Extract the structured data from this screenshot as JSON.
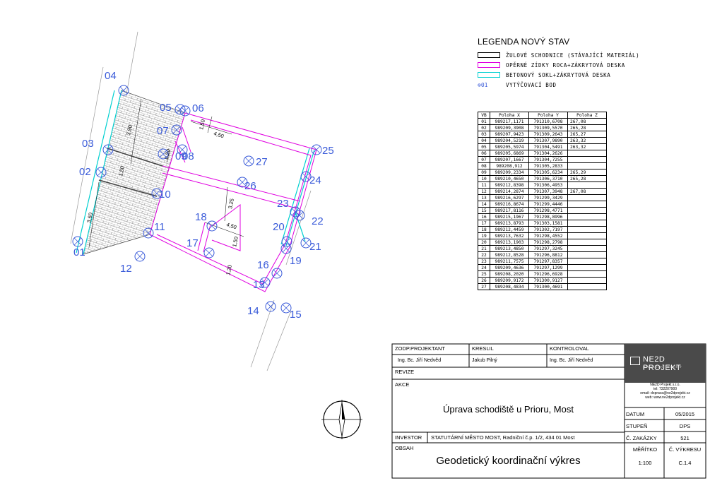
{
  "legend": {
    "title": "LEGENDA NOVÝ STAV",
    "items": [
      {
        "label": "ŽULOVÉ SCHODNICE (STÁVAJÍCÍ MATERIÁL)",
        "color": "#000000"
      },
      {
        "label": "OPĚRNÉ ZÍDKY ROCA+ZÁKRYTOVÁ DESKA",
        "color": "#e000e0"
      },
      {
        "label": "BETONOVÝ SOKL+ZÁKRYTOVÁ DESKA",
        "color": "#00d0d0"
      },
      {
        "label": "VYTÝČOVACÍ BOD",
        "color": "#3a5bd9",
        "prefix": "01"
      }
    ]
  },
  "points_table": {
    "headers": [
      "VB",
      "Poloha X",
      "Poloha Y",
      "Poloha Z"
    ],
    "rows": [
      [
        "01",
        "989217,1171",
        "791310,6708",
        "267,08"
      ],
      [
        "02",
        "989209,3908",
        "791309,5570",
        "265,28"
      ],
      [
        "03",
        "989207,9423",
        "791309,2643",
        "265,27"
      ],
      [
        "04",
        "989204,5219",
        "791307,9890",
        "263,32"
      ],
      [
        "05",
        "989205,5974",
        "791304,5491",
        "263,32"
      ],
      [
        "06",
        "989205,6869",
        "791304,2626",
        ""
      ],
      [
        "07",
        "989207,1667",
        "791304,7255",
        ""
      ],
      [
        "08",
        "989208,912",
        "791305,2833",
        ""
      ],
      [
        "09",
        "989209,2334",
        "791305,6234",
        "265,29"
      ],
      [
        "10",
        "989210,4650",
        "791306,3710",
        "265,28"
      ],
      [
        "11",
        "989212,8398",
        "791306,4953",
        ""
      ],
      [
        "12",
        "989214,2874",
        "791307,3948",
        "267,08"
      ],
      [
        "13",
        "989216,6297",
        "791299,3429",
        ""
      ],
      [
        "14",
        "989216,8674",
        "791299,4446",
        ""
      ],
      [
        "15",
        "989217,8116",
        "791298,4771",
        ""
      ],
      [
        "16",
        "989215,1967",
        "791298,8996",
        ""
      ],
      [
        "17",
        "989213,8793",
        "791303,1581",
        ""
      ],
      [
        "18",
        "989212,4459",
        "791302,7197",
        ""
      ],
      [
        "19",
        "989213,7632",
        "791298,4552",
        ""
      ],
      [
        "20",
        "989213,1903",
        "791298,2798",
        ""
      ],
      [
        "21",
        "989213,4850",
        "791297,3245",
        ""
      ],
      [
        "22",
        "989212,8528",
        "791296,8812",
        ""
      ],
      [
        "23",
        "989211,7575",
        "791297,8357",
        ""
      ],
      [
        "24",
        "989209,4636",
        "791297,1299",
        ""
      ],
      [
        "25",
        "989208,2020",
        "791296,6928",
        ""
      ],
      [
        "26",
        "989209,9172",
        "791300,9127",
        ""
      ],
      [
        "27",
        "989208,4834",
        "791300,4691",
        ""
      ]
    ]
  },
  "plan": {
    "point_labels": [
      {
        "id": "01"
      },
      {
        "id": "02"
      },
      {
        "id": "03"
      },
      {
        "id": "04"
      },
      {
        "id": "05"
      },
      {
        "id": "06"
      },
      {
        "id": "07"
      },
      {
        "id": "08"
      },
      {
        "id": "09"
      },
      {
        "id": "10"
      },
      {
        "id": "11"
      },
      {
        "id": "12"
      },
      {
        "id": "13"
      },
      {
        "id": "14"
      },
      {
        "id": "15"
      },
      {
        "id": "16"
      },
      {
        "id": "17"
      },
      {
        "id": "18"
      },
      {
        "id": "19"
      },
      {
        "id": "20"
      },
      {
        "id": "21"
      },
      {
        "id": "22"
      },
      {
        "id": "23"
      },
      {
        "id": "24"
      },
      {
        "id": "25"
      },
      {
        "id": "26"
      },
      {
        "id": "27"
      }
    ],
    "dimensions": [
      "3,90",
      "1,50",
      "4,50",
      "0,30",
      "1,50",
      "3,25",
      "4,50",
      "3,60",
      "1,50",
      "1,20"
    ]
  },
  "title_block": {
    "responsible_label": "ZODP.PROJEKTANT",
    "responsible_name": "Ing. Bc. Jiří Nedvěd",
    "drew_label": "KRESLIL",
    "drew_name": "Jakub Pilný",
    "checked_label": "KONTROLOVAL",
    "checked_name": "Ing. Bc. Jiří Nedvěd",
    "revision_label": "REVIZE",
    "action_label": "AKCE",
    "action_value": "Úprava schodiště u Prioru, Most",
    "investor_label": "INVESTOR",
    "investor_value": "STATUTÁRNÍ MĚSTO MOST, Radniční č.p. 1/2, 434 01 Most",
    "content_label": "OBSAH",
    "content_value": "Geodetický koordinační výkres",
    "date_label": "DATUM",
    "date_value": "05/2015",
    "stage_label": "STUPEŇ",
    "stage_value": "DPS",
    "order_label": "Č. ZAKÁZKY",
    "order_value": "521",
    "scale_label": "MĚŘÍTKO",
    "scale_value": "1:100",
    "drawing_no_label": "Č. VÝKRESU",
    "drawing_no_value": "C.1.4"
  },
  "company": {
    "logo_text": "NE2D PROJEKT",
    "logo_sub": "projekční ateliér",
    "lines": [
      "NE2D Projekt s.r.o.",
      "tel: 732207900",
      "email: dopravа@ne2dprojekt.cz",
      "web: www.ne2dprojekt.cz"
    ]
  }
}
